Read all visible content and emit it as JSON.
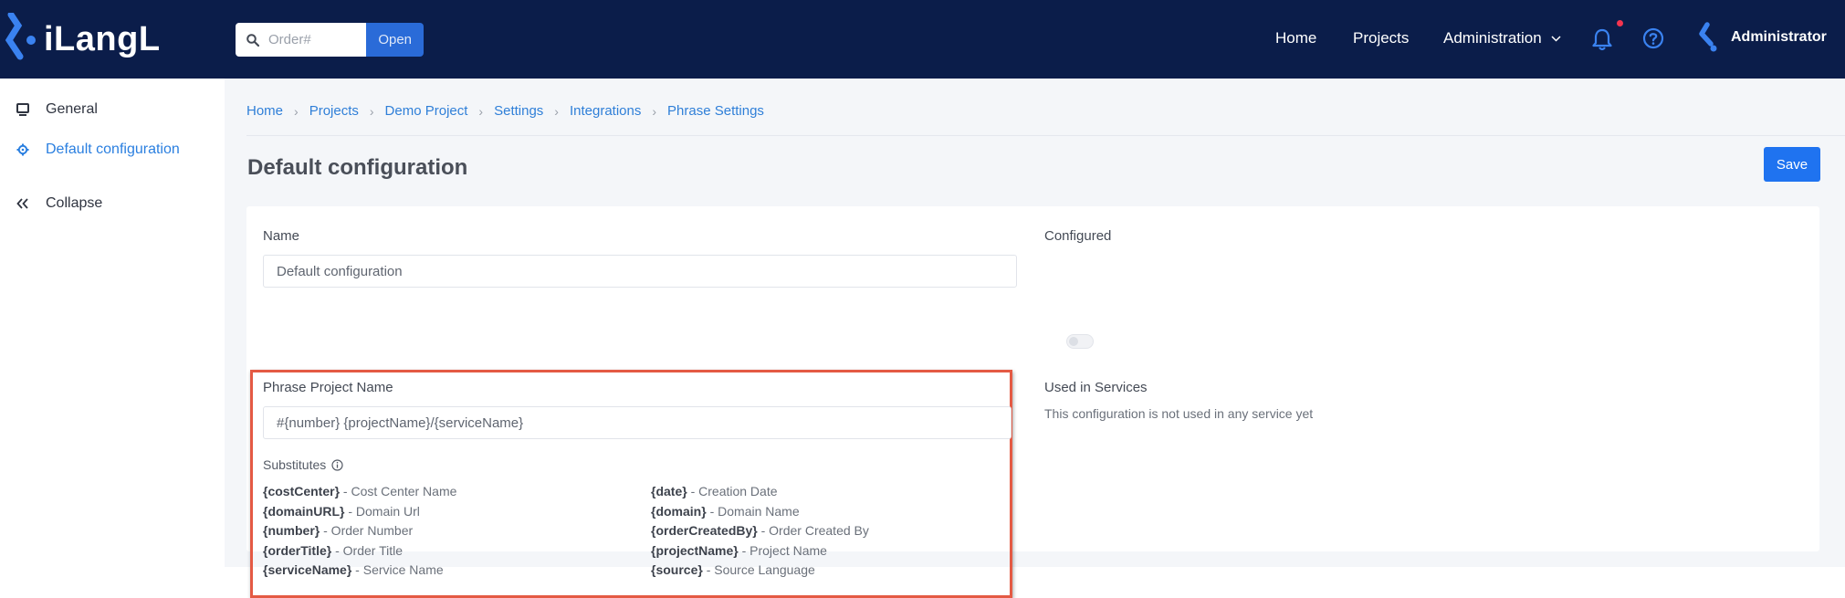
{
  "header": {
    "logo_text": "iLangL",
    "search": {
      "placeholder": "Order#",
      "button": "Open"
    },
    "nav": {
      "home": "Home",
      "projects": "Projects",
      "administration": "Administration"
    },
    "user": "Administrator"
  },
  "sidebar": {
    "items": [
      {
        "label": "General",
        "icon": "monitor-icon"
      },
      {
        "label": "Default configuration",
        "icon": "gear-icon"
      },
      {
        "label": "Collapse",
        "icon": "double-chevron-left-icon"
      }
    ]
  },
  "breadcrumb": [
    "Home",
    "Projects",
    "Demo Project",
    "Settings",
    "Integrations",
    "Phrase Settings"
  ],
  "page": {
    "title": "Default configuration",
    "save": "Save"
  },
  "form": {
    "name_label": "Name",
    "name_value": "Default configuration",
    "configured_label": "Configured",
    "used_label": "Used in Services",
    "used_text": "This configuration is not used in any service yet",
    "phrase_label": "Phrase Project Name",
    "phrase_value": "#{number} {projectName}/{serviceName}",
    "subs_label": "Substitutes",
    "subs_left": [
      {
        "key": "{costCenter}",
        "desc": " - Cost Center Name"
      },
      {
        "key": "{domainURL}",
        "desc": " - Domain Url"
      },
      {
        "key": "{number}",
        "desc": " - Order Number"
      },
      {
        "key": "{orderTitle}",
        "desc": " - Order Title"
      },
      {
        "key": "{serviceName}",
        "desc": " - Service Name"
      }
    ],
    "subs_right": [
      {
        "key": "{date}",
        "desc": " - Creation Date"
      },
      {
        "key": "{domain}",
        "desc": " - Domain Name"
      },
      {
        "key": "{orderCreatedBy}",
        "desc": " - Order Created By"
      },
      {
        "key": "{projectName}",
        "desc": " - Project Name"
      },
      {
        "key": "{source}",
        "desc": " - Source Language"
      }
    ]
  },
  "colors": {
    "header_bg": "#0b1d4a",
    "accent": "#1f73f0",
    "link": "#2f7fd8",
    "highlight": "#e45a44",
    "notification": "#f4344f"
  }
}
